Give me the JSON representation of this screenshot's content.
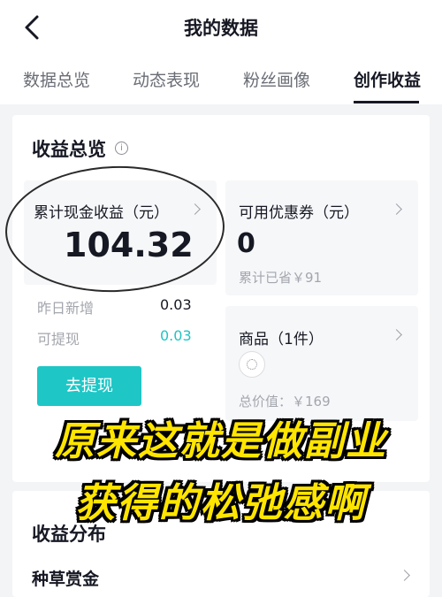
{
  "header": {
    "title": "我的数据"
  },
  "tabs": [
    {
      "label": "数据总览",
      "active": false
    },
    {
      "label": "动态表现",
      "active": false
    },
    {
      "label": "粉丝画像",
      "active": false
    },
    {
      "label": "创作收益",
      "active": true
    }
  ],
  "overview": {
    "title": "收益总览",
    "cash": {
      "label": "累计现金收益（元）",
      "value": "104.32"
    },
    "yesterday": {
      "label": "昨日新增",
      "value": "0.03"
    },
    "withdrawable": {
      "label": "可提现",
      "value": "0.03"
    },
    "withdraw_button": "去提现",
    "coupons": {
      "label": "可用优惠券（元）",
      "value": "0",
      "saved": "累计已省￥91"
    },
    "products": {
      "label": "商品（1件）",
      "total": "总价值：￥169"
    }
  },
  "distribution": {
    "title": "收益分布",
    "first_row": "种草赏金"
  },
  "overlay": {
    "line1": "原来这就是做副业",
    "line2": "获得的松弛感啊"
  },
  "colors": {
    "accent": "#1fc6c6",
    "overlay_text": "#ffe500",
    "overlay_stroke": "#000000"
  },
  "icons": {
    "back": "chevron-left-icon",
    "info": "info-icon",
    "arrow": "chevron-right-icon"
  }
}
